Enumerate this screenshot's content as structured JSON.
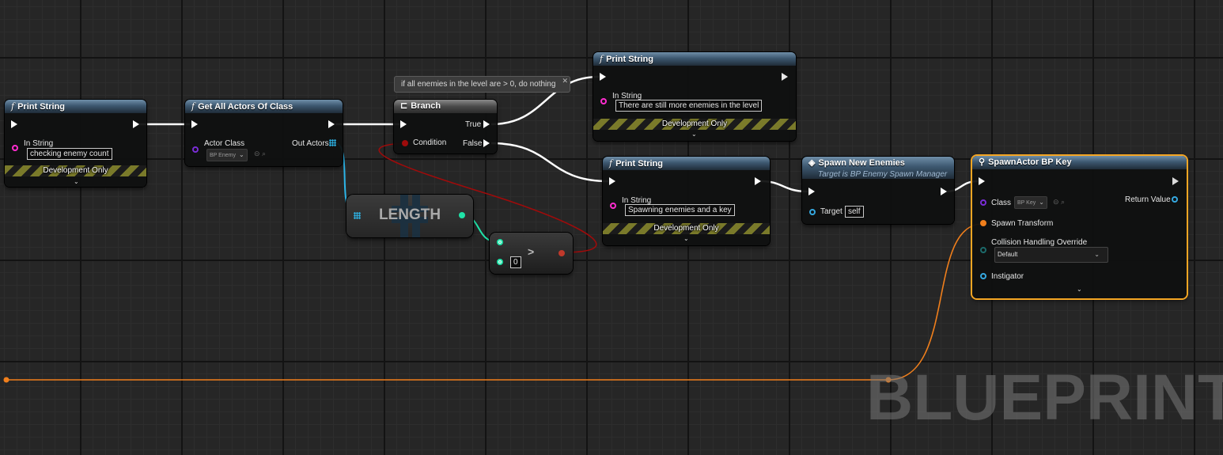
{
  "comment": {
    "text": "if all enemies in the level are > 0, do nothing"
  },
  "nodes": {
    "print_string_1": {
      "title": "Print String",
      "in_string_label": "In String",
      "in_string_value": "checking enemy count",
      "dev_only": "Development Only"
    },
    "get_all_actors": {
      "title": "Get All Actors Of Class",
      "actor_class_label": "Actor Class",
      "actor_class_value": "BP Enemy",
      "out_actors_label": "Out Actors"
    },
    "branch": {
      "title": "Branch",
      "true_label": "True",
      "false_label": "False",
      "condition_label": "Condition"
    },
    "length": {
      "title": "LENGTH"
    },
    "greater": {
      "symbol": ">",
      "value": "0"
    },
    "print_string_2": {
      "title": "Print String",
      "in_string_label": "In String",
      "in_string_value": "There are still more enemies in the level",
      "dev_only": "Development Only"
    },
    "print_string_3": {
      "title": "Print String",
      "in_string_label": "In String",
      "in_string_value": "Spawning enemies and a key",
      "dev_only": "Development Only"
    },
    "spawn_new_enemies": {
      "title": "Spawn New Enemies",
      "subtitle": "Target is BP Enemy Spawn Manager",
      "target_label": "Target",
      "target_value": "self"
    },
    "spawn_actor": {
      "title": "SpawnActor BP Key",
      "class_label": "Class",
      "class_value": "BP Key",
      "return_value_label": "Return Value",
      "spawn_transform_label": "Spawn Transform",
      "collision_label": "Collision Handling Override",
      "collision_value": "Default",
      "instigator_label": "Instigator"
    }
  },
  "watermark": "BLUEPRINT",
  "colors": {
    "exec": "#ffffff",
    "string_pin": "#ff2ccf",
    "class_pin": "#7a2dd6",
    "array_pin": "#2db5e8",
    "int_pin": "#1fe3a8",
    "bool_pin": "#9e0b0b",
    "object_pin": "#35a8e0",
    "struct_pin": "#f07f1c",
    "selected_outline": "#f5a623"
  }
}
